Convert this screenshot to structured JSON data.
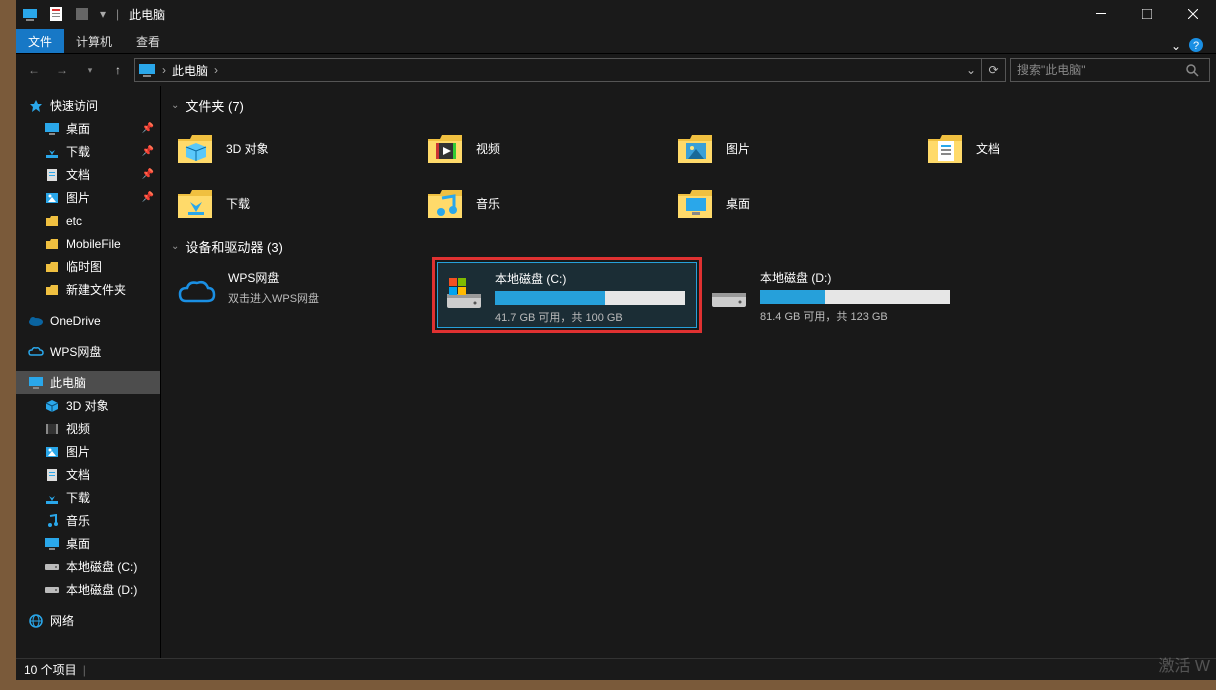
{
  "titlebar": {
    "title": "此电脑"
  },
  "ribbon": {
    "file": "文件",
    "computer": "计算机",
    "view": "查看"
  },
  "address": {
    "crumb": "此电脑",
    "search_placeholder": "搜索\"此电脑\""
  },
  "sidebar": {
    "quick_access": "快速访问",
    "quick_children": [
      {
        "label": "桌面",
        "pin": true,
        "icon": "desktop"
      },
      {
        "label": "下载",
        "pin": true,
        "icon": "download"
      },
      {
        "label": "文档",
        "pin": true,
        "icon": "document"
      },
      {
        "label": "图片",
        "pin": true,
        "icon": "picture"
      },
      {
        "label": "etc",
        "pin": false,
        "icon": "folder"
      },
      {
        "label": "MobileFile",
        "pin": false,
        "icon": "folder"
      },
      {
        "label": "临时图",
        "pin": false,
        "icon": "folder"
      },
      {
        "label": "新建文件夹",
        "pin": false,
        "icon": "folder"
      }
    ],
    "onedrive": "OneDrive",
    "wps": "WPS网盘",
    "this_pc": "此电脑",
    "pc_children": [
      {
        "label": "3D 对象",
        "icon": "3d"
      },
      {
        "label": "视频",
        "icon": "video"
      },
      {
        "label": "图片",
        "icon": "picture"
      },
      {
        "label": "文档",
        "icon": "document"
      },
      {
        "label": "下载",
        "icon": "download"
      },
      {
        "label": "音乐",
        "icon": "music"
      },
      {
        "label": "桌面",
        "icon": "desktop"
      },
      {
        "label": "本地磁盘 (C:)",
        "icon": "drive"
      },
      {
        "label": "本地磁盘 (D:)",
        "icon": "drive"
      }
    ],
    "network": "网络"
  },
  "groups": {
    "folders_header": "文件夹 (7)",
    "drives_header": "设备和驱动器 (3)"
  },
  "folders": [
    {
      "label": "3D 对象",
      "icon": "3d"
    },
    {
      "label": "视频",
      "icon": "video"
    },
    {
      "label": "图片",
      "icon": "picture"
    },
    {
      "label": "文档",
      "icon": "document"
    },
    {
      "label": "下载",
      "icon": "download"
    },
    {
      "label": "音乐",
      "icon": "music"
    },
    {
      "label": "桌面",
      "icon": "desktop"
    }
  ],
  "drives": [
    {
      "name": "WPS网盘",
      "sub": "双击进入WPS网盘",
      "icon": "cloud"
    },
    {
      "name": "本地磁盘 (C:)",
      "free": "41.7 GB 可用，共 100 GB",
      "fill": 58,
      "icon": "drive-c",
      "selected": true,
      "highlight": true
    },
    {
      "name": "本地磁盘 (D:)",
      "free": "81.4 GB 可用，共 123 GB",
      "fill": 34,
      "icon": "drive",
      "selected": false
    }
  ],
  "status": {
    "count": "10 个项目"
  },
  "watermark": "激活 W"
}
